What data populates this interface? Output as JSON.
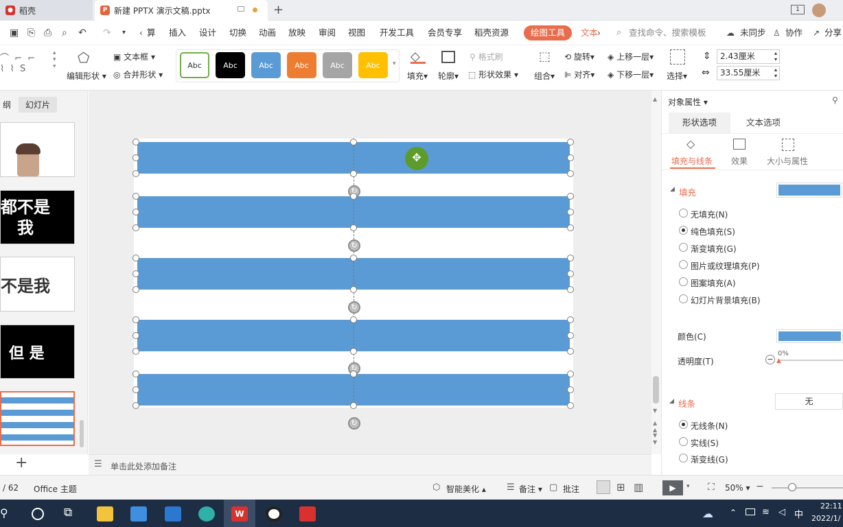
{
  "tabs": {
    "doc_label": "稻壳",
    "pptx_label": "新建 PPTX 演示文稿.pptx",
    "add_tab": "+"
  },
  "window": {
    "badge": "1"
  },
  "menu": {
    "items": [
      "算",
      "插入",
      "设计",
      "切换",
      "动画",
      "放映",
      "审阅",
      "视图",
      "开发工具",
      "会员专享",
      "稻壳资源"
    ],
    "active": "绘图工具",
    "more": "文本",
    "search": "查找命令、搜索模板",
    "sync": "未同步",
    "collab": "协作",
    "share": "分享"
  },
  "ribbon": {
    "edit_shape": "编辑形状",
    "text_box": "文本框",
    "merge_shape": "合并形状",
    "styles": [
      {
        "label": "Abc",
        "bg": "#ffffff",
        "fg": "#333333",
        "border": "#70ad47"
      },
      {
        "label": "Abc",
        "bg": "#000000",
        "fg": "#ffffff",
        "border": "#000000"
      },
      {
        "label": "Abc",
        "bg": "#5b9bd5",
        "fg": "#ffffff",
        "border": "#5b9bd5"
      },
      {
        "label": "Abc",
        "bg": "#ed7d31",
        "fg": "#ffffff",
        "border": "#ed7d31"
      },
      {
        "label": "Abc",
        "bg": "#a5a5a5",
        "fg": "#ffffff",
        "border": "#a5a5a5"
      },
      {
        "label": "Abc",
        "bg": "#ffc000",
        "fg": "#ffffff",
        "border": "#ffc000"
      }
    ],
    "fill": "填充",
    "outline": "轮廓",
    "format_painter": "格式刷",
    "shape_effect": "形状效果",
    "group": "组合",
    "rotate": "旋转",
    "align": "对齐",
    "bring_forward": "上移一层",
    "send_backward": "下移一层",
    "select": "选择",
    "height": "2.43厘米",
    "width": "33.55厘米"
  },
  "left_pane": {
    "tab_outline": "纲",
    "tab_slides": "幻灯片",
    "slides": [
      {
        "text": ""
      },
      {
        "text": "都不是\n我"
      },
      {
        "text": "不是我"
      },
      {
        "text": "但 是"
      },
      {
        "text": ""
      }
    ],
    "add": "+"
  },
  "notes": {
    "placeholder": "单击此处添加备注"
  },
  "right_pane": {
    "title": "对象属性",
    "tab_shape": "形状选项",
    "tab_text": "文本选项",
    "sub_fill_line": "填充与线条",
    "sub_effect": "效果",
    "sub_size": "大小与属性",
    "fill_header": "填充",
    "fill_options": [
      "无填充(N)",
      "纯色填充(S)",
      "渐变填充(G)",
      "图片或纹理填充(P)",
      "图案填充(A)",
      "幻灯片背景填充(B)"
    ],
    "fill_selected": 1,
    "color_label": "颜色(C)",
    "fill_color": "#5b9bd5",
    "transparency_label": "透明度(T)",
    "transparency_value": "0%",
    "line_header": "线条",
    "line_value": "无",
    "line_options": [
      "无线条(N)",
      "实线(S)",
      "渐变线(G)"
    ],
    "line_selected": 0
  },
  "status": {
    "page": "/ 62",
    "theme": "Office 主题",
    "beautify": "智能美化",
    "notes": "备注",
    "comment": "批注",
    "zoom": "50%"
  },
  "taskbar": {
    "time": "22:11",
    "date": "2022/1/",
    "ime": "中"
  },
  "colors": {
    "accent": "#e96c4c",
    "bar": "#5b9bd5",
    "taskbar": "#1c2d44"
  }
}
